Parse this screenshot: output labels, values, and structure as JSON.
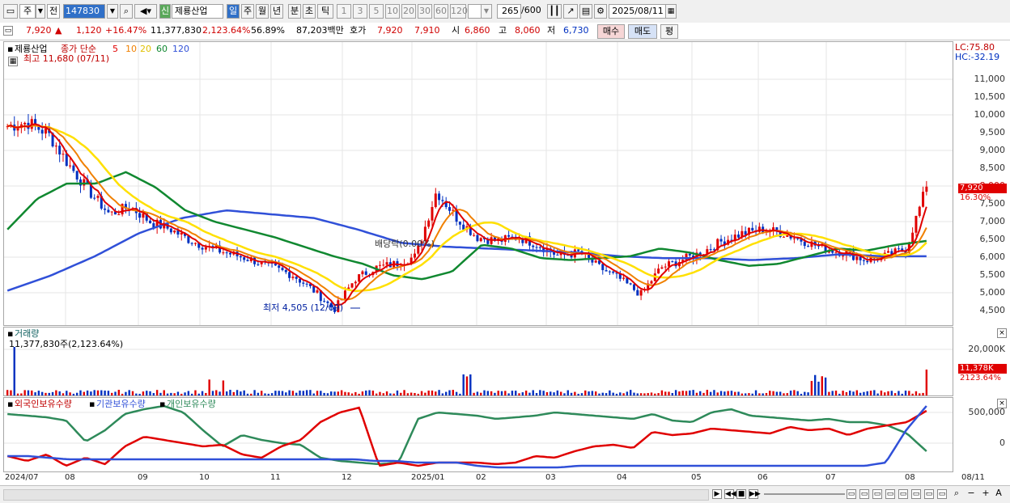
{
  "toolbar": {
    "market": "주",
    "period_prefix": "전",
    "code": "147830",
    "badge_new": "신",
    "stock_name": "제룡산업",
    "periods": [
      "일",
      "주",
      "월",
      "년",
      "분",
      "초",
      "틱"
    ],
    "intervals": [
      "1",
      "3",
      "5",
      "10",
      "20",
      "30",
      "60",
      "120"
    ],
    "count": "265",
    "count_total": "/600",
    "date": "2025/08/11"
  },
  "info": {
    "price": "7,920",
    "change": "1,120",
    "change_pct": "+16.47%",
    "volume": "11,377,830",
    "volume_pct": "2,123.64%",
    "ratio": "56.89%",
    "amount": "87,203백만",
    "ask_label": "호가",
    "ask1": "7,920",
    "ask2": "7,910",
    "open_label": "시",
    "open": "6,860",
    "high_label": "고",
    "high": "8,060",
    "low_label": "저",
    "low": "6,730",
    "buy_btn": "매수",
    "sell_btn": "매도",
    "avg_btn": "평"
  },
  "price_panel": {
    "name": "제룡산업",
    "ma_label": "종가 단순",
    "ma_periods": [
      "5",
      "10",
      "20",
      "60",
      "120"
    ],
    "ma_colors": [
      "#e00000",
      "#f08000",
      "#ffe000",
      "#108830",
      "#3050d8"
    ],
    "high_note": "최고 11,680 (07/11)",
    "low_note": "최저 4,505 (12/09)",
    "dividend_note": "배당락(0.00%)",
    "lc": "LC:75.80",
    "hc": "HC:-32.19",
    "last_price_tag": "7,920",
    "last_pct_tag": "16.30%",
    "y_ticks": [
      "11,000",
      "10,500",
      "10,000",
      "9,500",
      "9,000",
      "8,500",
      "8,000",
      "7,500",
      "7,000",
      "6,500",
      "6,000",
      "5,500",
      "5,000",
      "4,500"
    ]
  },
  "volume_panel": {
    "title": "거래량",
    "note": "11,377,830주(2,123.64%)",
    "y_tick": "20,000K",
    "tag": "11,378K",
    "tag_pct": "2123.64%"
  },
  "holding_panel": {
    "foreign": "외국인보유수량",
    "inst": "기관보유수량",
    "indiv": "개인보유수량",
    "y_ticks": [
      "500,000",
      "0"
    ]
  },
  "x_axis": [
    "2024/07",
    "08",
    "09",
    "10",
    "11",
    "12",
    "2025/01",
    "02",
    "03",
    "04",
    "05",
    "06",
    "07",
    "08",
    "08/11"
  ],
  "chart_data": {
    "type": "candlestick",
    "title": "",
    "xlabel": "",
    "ylabel": "",
    "ylim": [
      4300,
      11700
    ],
    "months": [
      "2024/07",
      "08",
      "09",
      "10",
      "11",
      "12",
      "2025/01",
      "02",
      "03",
      "04",
      "05",
      "06",
      "07",
      "08"
    ],
    "close_path": [
      9500,
      9600,
      9300,
      8500,
      7800,
      7200,
      7400,
      7000,
      6800,
      6500,
      6300,
      6150,
      6000,
      5800,
      5600,
      5200,
      4700,
      5500,
      5800,
      5900,
      6100,
      7800,
      7100,
      6600,
      6500,
      6600,
      6400,
      6100,
      6200,
      5800,
      5500,
      5100,
      5800,
      6000,
      6200,
      6500,
      6700,
      6800,
      6700,
      6500,
      6300,
      6200,
      6000,
      6100,
      6300,
      7920
    ],
    "ma60_path": [
      6800,
      7600,
      8000,
      8000,
      8300,
      7900,
      7300,
      7000,
      6800,
      6600,
      6350,
      6100,
      5900,
      5600,
      5500,
      5700,
      6400,
      6300,
      6050,
      6000,
      6050,
      6100,
      6300,
      6200,
      6000,
      5850,
      5900,
      6100,
      6300,
      6250,
      6400,
      6500
    ],
    "ma120_path": [
      5200,
      5600,
      6100,
      6700,
      7100,
      7300,
      7200,
      7100,
      6800,
      6450,
      6350,
      6300,
      6250,
      6200,
      6100,
      6050,
      6050,
      6000,
      6050,
      6150,
      6100,
      6100
    ],
    "last_price": 7920,
    "volume_tags": [
      "11,378K"
    ]
  }
}
